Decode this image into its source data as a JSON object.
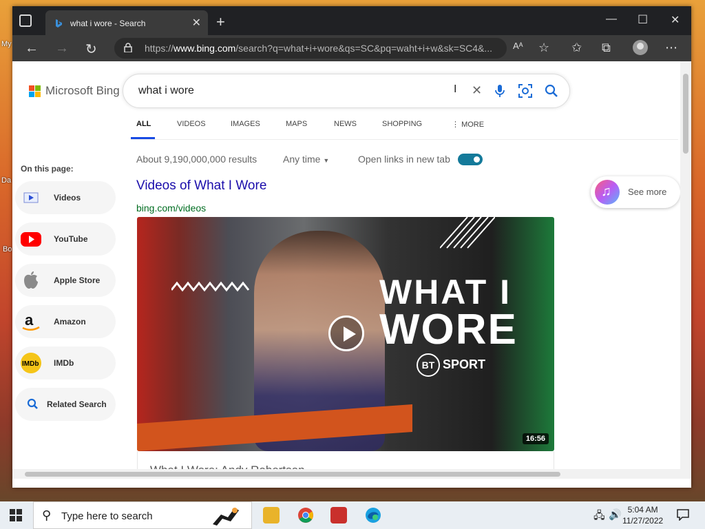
{
  "desktop": {
    "left_labels": [
      "My",
      "Da",
      "Bo"
    ]
  },
  "browser": {
    "tab_title": "what i wore - Search",
    "url_prefix": "https://",
    "url_host": "www.bing.com",
    "url_path": "/search?q=what+i+wore&qs=SC&pq=waht+i+w&sk=SC4&..."
  },
  "search": {
    "logo_text": "Microsoft Bing",
    "query": "what i wore",
    "tabs": [
      "ALL",
      "VIDEOS",
      "IMAGES",
      "MAPS",
      "NEWS",
      "SHOPPING",
      "MORE"
    ],
    "active_tab": "ALL"
  },
  "sidebar": {
    "title": "On this page:",
    "items": [
      {
        "label": "Videos",
        "icon": "video-icon"
      },
      {
        "label": "YouTube",
        "icon": "youtube-icon"
      },
      {
        "label": "Apple Store",
        "icon": "apple-icon"
      },
      {
        "label": "Amazon",
        "icon": "amazon-icon"
      },
      {
        "label": "IMDb",
        "icon": "imdb-icon"
      },
      {
        "label": "Related Search",
        "icon": "search-icon"
      }
    ]
  },
  "results": {
    "stats": "About 9,190,000,000 results",
    "time_filter": "Any time",
    "new_tab_label": "Open links in new tab",
    "new_tab_enabled": true,
    "title": "Videos of What I Wore",
    "url": "bing.com/videos",
    "video": {
      "line1": "WHAT I",
      "line2": "WORE",
      "brand_circle": "BT",
      "brand_text": "SPORT",
      "duration": "16:56",
      "caption": "What I Wore: Andy Robertson"
    }
  },
  "see_more": {
    "label": "See more"
  },
  "taskbar": {
    "search_placeholder": "Type here to search",
    "time": "5:04 AM",
    "date": "11/27/2022"
  },
  "colors": {
    "bing_blue": "#174ae4",
    "link": "#1a0dab",
    "url_green": "#006d21",
    "toggle": "#147a9a"
  }
}
